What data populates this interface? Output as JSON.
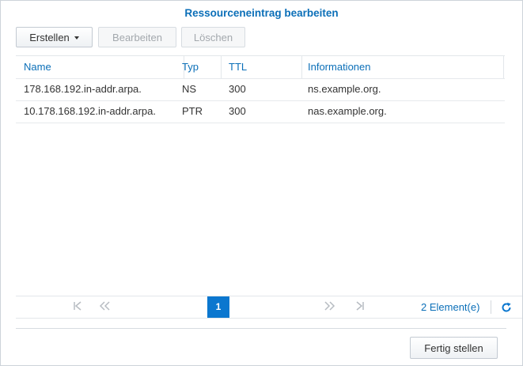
{
  "dialog": {
    "title": "Ressourceneintrag bearbeiten"
  },
  "toolbar": {
    "create_label": "Erstellen",
    "edit_label": "Bearbeiten",
    "delete_label": "Löschen"
  },
  "table": {
    "columns": [
      "Name",
      "Typ",
      "TTL",
      "Informationen"
    ],
    "rows": [
      [
        "178.168.192.in-addr.arpa.",
        "NS",
        "300",
        "ns.example.org."
      ],
      [
        "10.178.168.192.in-addr.arpa.",
        "PTR",
        "300",
        "nas.example.org."
      ]
    ]
  },
  "pager": {
    "current_page": "1",
    "count_label": "2 Element(e)",
    "first_icon": "first-page-icon",
    "prev_icon": "prev-page-icon",
    "next_icon": "next-page-icon",
    "last_icon": "last-page-icon",
    "refresh_icon": "refresh-icon"
  },
  "footer": {
    "finish_label": "Fertig stellen"
  },
  "colors": {
    "accent": "#0b6fb8",
    "page_active": "#0b77cf"
  }
}
